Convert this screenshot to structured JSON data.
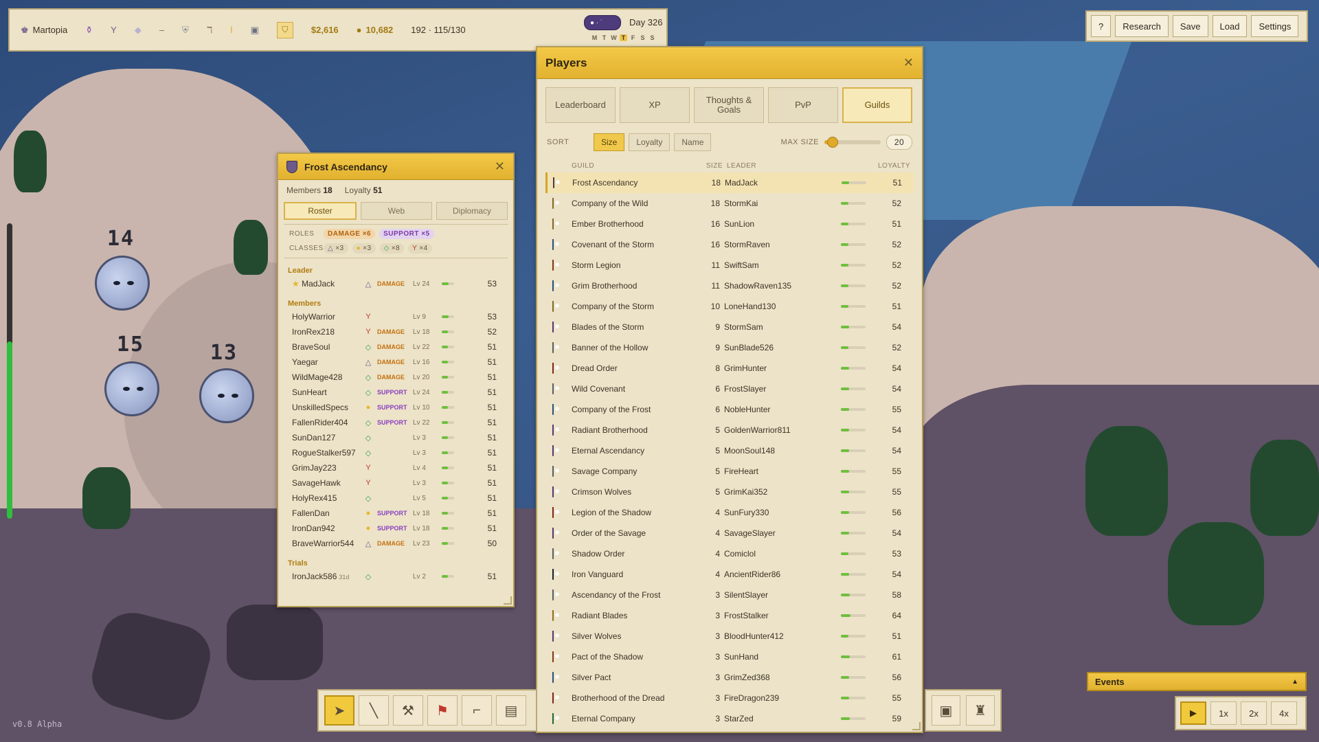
{
  "status": {
    "city": "Martopia",
    "money": "$2,616",
    "gold": "10,682",
    "population": "192 · 115/130",
    "day": "Day 326",
    "weekdays": [
      "M",
      "T",
      "W",
      "T",
      "F",
      "S",
      "S"
    ],
    "today_index": 3
  },
  "menu": {
    "help": "?",
    "research": "Research",
    "save": "Save",
    "load": "Load",
    "settings": "Settings"
  },
  "players": {
    "title": "Players",
    "tabs": [
      "Leaderboard",
      "XP",
      "Thoughts & Goals",
      "PvP",
      "Guilds"
    ],
    "active_tab": 4,
    "sort_label": "SORT",
    "sort_options": [
      "Size",
      "Loyalty",
      "Name"
    ],
    "active_sort": 0,
    "max_size_label": "MAX SIZE",
    "max_size": "20",
    "max_size_fraction": 0.15,
    "columns": {
      "guild": "GUILD",
      "size": "SIZE",
      "leader": "LEADER",
      "loyalty": "LOYALTY"
    },
    "guilds": [
      {
        "name": "Frost Ascendancy",
        "size": 18,
        "leader": "MadJack",
        "loyalty": 51,
        "color": "#6b5a8a",
        "selected": true
      },
      {
        "name": "Company of the Wild",
        "size": 18,
        "leader": "StormKai",
        "loyalty": 52,
        "color": "#c9a23a"
      },
      {
        "name": "Ember Brotherhood",
        "size": 16,
        "leader": "SunLion",
        "loyalty": 51,
        "color": "#c9a23a"
      },
      {
        "name": "Covenant of the Storm",
        "size": 16,
        "leader": "StormRaven",
        "loyalty": 52,
        "color": "#3d7cc0"
      },
      {
        "name": "Storm Legion",
        "size": 11,
        "leader": "SwiftSam",
        "loyalty": 52,
        "color": "#c65a1e"
      },
      {
        "name": "Grim Brotherhood",
        "size": 11,
        "leader": "ShadowRaven135",
        "loyalty": 52,
        "color": "#3d7cc0"
      },
      {
        "name": "Company of the Storm",
        "size": 10,
        "leader": "LoneHand130",
        "loyalty": 51,
        "color": "#c9a23a"
      },
      {
        "name": "Blades of the Storm",
        "size": 9,
        "leader": "StormSam",
        "loyalty": 54,
        "color": "#8a4fb0"
      },
      {
        "name": "Banner of the Hollow",
        "size": 9,
        "leader": "SunBlade526",
        "loyalty": 52,
        "color": "#8a8f96"
      },
      {
        "name": "Dread Order",
        "size": 8,
        "leader": "GrimHunter",
        "loyalty": 54,
        "color": "#c0392b"
      },
      {
        "name": "Wild Covenant",
        "size": 6,
        "leader": "FrostSlayer",
        "loyalty": 54,
        "color": "#8a8f96"
      },
      {
        "name": "Company of the Frost",
        "size": 6,
        "leader": "NobleHunter",
        "loyalty": 55,
        "color": "#3d7cc0"
      },
      {
        "name": "Radiant Brotherhood",
        "size": 5,
        "leader": "GoldenWarrior811",
        "loyalty": 54,
        "color": "#8a4fb0"
      },
      {
        "name": "Eternal Ascendancy",
        "size": 5,
        "leader": "MoonSoul148",
        "loyalty": 54,
        "color": "#8a4fb0"
      },
      {
        "name": "Savage Company",
        "size": 5,
        "leader": "FireHeart",
        "loyalty": 55,
        "color": "#8a8f96"
      },
      {
        "name": "Crimson Wolves",
        "size": 5,
        "leader": "GrimKai352",
        "loyalty": 55,
        "color": "#8a4fb0"
      },
      {
        "name": "Legion of the Shadow",
        "size": 4,
        "leader": "SunFury330",
        "loyalty": 56,
        "color": "#c0392b"
      },
      {
        "name": "Order of the Savage",
        "size": 4,
        "leader": "SavageSlayer",
        "loyalty": 54,
        "color": "#8a4fb0"
      },
      {
        "name": "Shadow Order",
        "size": 4,
        "leader": "Comiclol",
        "loyalty": 53,
        "color": "#8a8f96"
      },
      {
        "name": "Iron Vanguard",
        "size": 4,
        "leader": "AncientRider86",
        "loyalty": 54,
        "color": "#2f3440"
      },
      {
        "name": "Ascendancy of the Frost",
        "size": 3,
        "leader": "SilentSlayer",
        "loyalty": 58,
        "color": "#8a8f96"
      },
      {
        "name": "Radiant Blades",
        "size": 3,
        "leader": "FrostStalker",
        "loyalty": 64,
        "color": "#e0a92a"
      },
      {
        "name": "Silver Wolves",
        "size": 3,
        "leader": "BloodHunter412",
        "loyalty": 51,
        "color": "#8a4fb0"
      },
      {
        "name": "Pact of the Shadow",
        "size": 3,
        "leader": "SunHand",
        "loyalty": 61,
        "color": "#c65a1e"
      },
      {
        "name": "Silver Pact",
        "size": 3,
        "leader": "GrimZed368",
        "loyalty": 56,
        "color": "#3d7cc0"
      },
      {
        "name": "Brotherhood of the Dread",
        "size": 3,
        "leader": "FireDragon239",
        "loyalty": 55,
        "color": "#c0392b"
      },
      {
        "name": "Eternal Company",
        "size": 3,
        "leader": "StarZed",
        "loyalty": 59,
        "color": "#2fa24a"
      }
    ]
  },
  "guild_detail": {
    "title": "Frost Ascendancy",
    "members_label": "Members",
    "members_count": "18",
    "loyalty_label": "Loyalty",
    "loyalty_value": "51",
    "tabs": [
      "Roster",
      "Web",
      "Diplomacy"
    ],
    "active_tab": 0,
    "roles_label": "ROLES",
    "roles": [
      {
        "text": "DAMAGE ×6",
        "kind": "dmg"
      },
      {
        "text": "SUPPORT ×5",
        "kind": "sup"
      }
    ],
    "classes_label": "CLASSES",
    "classes": [
      {
        "icon": "△",
        "text": "×3",
        "color": "#6b5a8a"
      },
      {
        "icon": "●",
        "text": "×3",
        "color": "#e7b627"
      },
      {
        "icon": "◇",
        "text": "×8",
        "color": "#2fa24a"
      },
      {
        "icon": "Y",
        "text": "×4",
        "color": "#c0392b"
      }
    ],
    "leader_label": "Leader",
    "leader": {
      "name": "MadJack",
      "cls": "△",
      "cls_color": "#6b5a8a",
      "role": "DAMAGE",
      "lv": "Lv 24",
      "loyalty": "53"
    },
    "members_section": "Members",
    "members": [
      {
        "name": "HolyWarrior",
        "cls": "Y",
        "cls_color": "#c0392b",
        "role": "",
        "lv": "Lv 9",
        "loyalty": "53"
      },
      {
        "name": "IronRex218",
        "cls": "Y",
        "cls_color": "#c0392b",
        "role": "DAMAGE",
        "lv": "Lv 18",
        "loyalty": "52"
      },
      {
        "name": "BraveSoul",
        "cls": "◇",
        "cls_color": "#2fa24a",
        "role": "DAMAGE",
        "lv": "Lv 22",
        "loyalty": "51"
      },
      {
        "name": "Yaegar",
        "cls": "△",
        "cls_color": "#6b5a8a",
        "role": "DAMAGE",
        "lv": "Lv 16",
        "loyalty": "51"
      },
      {
        "name": "WildMage428",
        "cls": "◇",
        "cls_color": "#2fa24a",
        "role": "DAMAGE",
        "lv": "Lv 20",
        "loyalty": "51"
      },
      {
        "name": "SunHeart",
        "cls": "◇",
        "cls_color": "#2fa24a",
        "role": "SUPPORT",
        "lv": "Lv 24",
        "loyalty": "51"
      },
      {
        "name": "UnskilledSpecs",
        "cls": "●",
        "cls_color": "#e7b627",
        "role": "SUPPORT",
        "lv": "Lv 10",
        "loyalty": "51"
      },
      {
        "name": "FallenRider404",
        "cls": "◇",
        "cls_color": "#2fa24a",
        "role": "SUPPORT",
        "lv": "Lv 22",
        "loyalty": "51"
      },
      {
        "name": "SunDan127",
        "cls": "◇",
        "cls_color": "#2fa24a",
        "role": "",
        "lv": "Lv 3",
        "loyalty": "51"
      },
      {
        "name": "RogueStalker597",
        "cls": "◇",
        "cls_color": "#2fa24a",
        "role": "",
        "lv": "Lv 3",
        "loyalty": "51"
      },
      {
        "name": "GrimJay223",
        "cls": "Y",
        "cls_color": "#c0392b",
        "role": "",
        "lv": "Lv 4",
        "loyalty": "51"
      },
      {
        "name": "SavageHawk",
        "cls": "Y",
        "cls_color": "#c0392b",
        "role": "",
        "lv": "Lv 3",
        "loyalty": "51"
      },
      {
        "name": "HolyRex415",
        "cls": "◇",
        "cls_color": "#2fa24a",
        "role": "",
        "lv": "Lv 5",
        "loyalty": "51"
      },
      {
        "name": "FallenDan",
        "cls": "●",
        "cls_color": "#e7b627",
        "role": "SUPPORT",
        "lv": "Lv 18",
        "loyalty": "51"
      },
      {
        "name": "IronDan942",
        "cls": "●",
        "cls_color": "#e7b627",
        "role": "SUPPORT",
        "lv": "Lv 18",
        "loyalty": "51"
      },
      {
        "name": "BraveWarrior544",
        "cls": "△",
        "cls_color": "#6b5a8a",
        "role": "DAMAGE",
        "lv": "Lv 23",
        "loyalty": "50"
      }
    ],
    "trials_label": "Trials",
    "trials": [
      {
        "name": "IronJack586",
        "sub": "31d",
        "cls": "◇",
        "cls_color": "#2fa24a",
        "role": "",
        "lv": "Lv 2",
        "loyalty": "51"
      }
    ]
  },
  "mobs": [
    "14",
    "15",
    "13"
  ],
  "health_fraction": 0.6,
  "version": "v0.8 Alpha",
  "events_label": "Events",
  "speed": [
    "1x",
    "2x",
    "4x"
  ]
}
